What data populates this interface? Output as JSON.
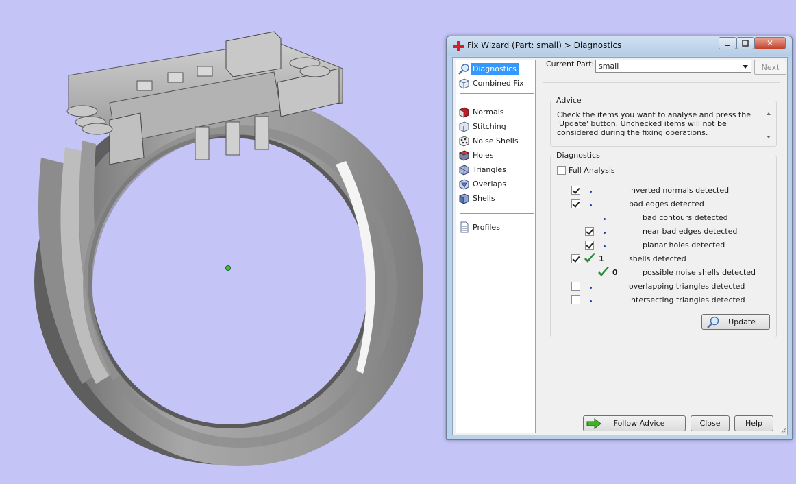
{
  "window": {
    "title": "Fix Wizard (Part: small) > Diagnostics",
    "close_glyph": "✕"
  },
  "sidebar": {
    "items": [
      {
        "label": "Diagnostics",
        "icon": "magnifier-icon",
        "selected": true
      },
      {
        "label": "Combined Fix",
        "icon": "cube-outline-icon"
      },
      {
        "label": "Normals",
        "icon": "normals-cube-icon"
      },
      {
        "label": "Stitching",
        "icon": "stitching-cube-icon"
      },
      {
        "label": "Noise Shells",
        "icon": "noise-shells-icon"
      },
      {
        "label": "Holes",
        "icon": "holes-cube-icon"
      },
      {
        "label": "Triangles",
        "icon": "triangles-icon"
      },
      {
        "label": "Overlaps",
        "icon": "overlaps-icon"
      },
      {
        "label": "Shells",
        "icon": "shells-icon"
      },
      {
        "label": "Profiles",
        "icon": "document-icon"
      }
    ]
  },
  "part": {
    "label": "Current Part:",
    "value": "small",
    "next_label": "Next"
  },
  "advice": {
    "title": "Advice",
    "text": "Check the items you want to analyse and press the 'Update' button. Unchecked items will not be considered during the fixing operations."
  },
  "diagnostics": {
    "title": "Diagnostics",
    "full_analysis_label": "Full Analysis",
    "full_analysis_checked": false,
    "rows": [
      {
        "label": "inverted normals detected",
        "checked": true,
        "indent": 0,
        "status": "dot"
      },
      {
        "label": "bad edges detected",
        "checked": true,
        "indent": 0,
        "status": "dot"
      },
      {
        "label": "bad contours detected",
        "checked": null,
        "indent": 1,
        "status": "dot"
      },
      {
        "label": "near bad edges detected",
        "checked": true,
        "indent": 1,
        "status": "dot"
      },
      {
        "label": "planar holes detected",
        "checked": true,
        "indent": 1,
        "status": "dot"
      },
      {
        "label": "shells detected",
        "checked": true,
        "indent": 0,
        "status": "ok",
        "count": "1"
      },
      {
        "label": "possible noise shells detected",
        "checked": null,
        "indent": 1,
        "status": "ok",
        "count": "0"
      },
      {
        "label": "overlapping triangles detected",
        "checked": false,
        "indent": 0,
        "status": "dot"
      },
      {
        "label": "intersecting triangles detected",
        "checked": false,
        "indent": 0,
        "status": "dot"
      }
    ],
    "update_label": "Update"
  },
  "footer": {
    "follow_label": "Follow Advice",
    "close_label": "Close",
    "help_label": "Help"
  },
  "colors": {
    "background": "#c4c4f6",
    "ring": "#a9a9a9",
    "selection": "#3399ff",
    "check_green": "#2e8b3e"
  }
}
